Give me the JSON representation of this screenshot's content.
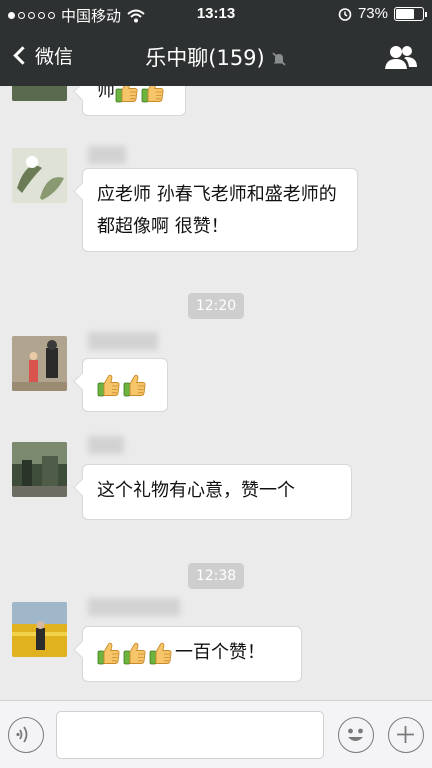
{
  "status_bar": {
    "carrier": "中国移动",
    "time": "13:13",
    "battery": "73%",
    "battery_level": 0.73
  },
  "nav": {
    "back_label": "微信",
    "title": "乐中聊(159)"
  },
  "messages": [
    {
      "type": "text",
      "tail_text": "师"
    },
    {
      "type": "text",
      "text": "应老师 孙春飞老师和盛老师的都超像啊 很赞！"
    },
    {
      "type": "time",
      "text": "12:20"
    },
    {
      "type": "emoji"
    },
    {
      "type": "text",
      "text": "这个礼物有心意，赞一个"
    },
    {
      "type": "time",
      "text": "12:38"
    },
    {
      "type": "text",
      "text": "一百个赞！"
    }
  ],
  "icons": {
    "back": "chevron-left-icon",
    "mute": "bell-muted-icon",
    "contacts": "group-people-icon",
    "thumbs": "thumbs-up-emoji",
    "voice": "voice-icon",
    "emoji": "smile-icon",
    "plus": "plus-icon"
  },
  "colors": {
    "nav_bg": "#2e3132",
    "chat_bg": "#ebebeb",
    "bubble": "#ffffff",
    "time_badge": "#cecece"
  }
}
